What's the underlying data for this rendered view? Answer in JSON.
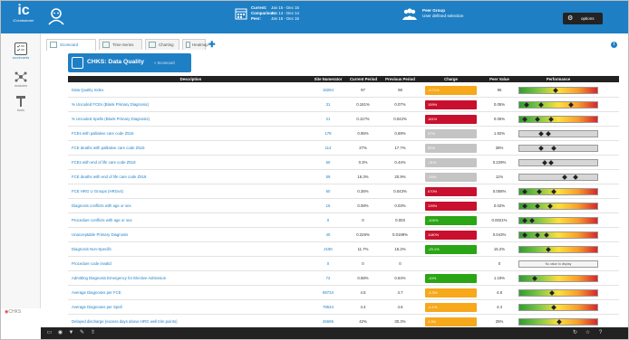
{
  "app": {
    "logo_text": "ic",
    "logo_sub": "iComissioner"
  },
  "header": {
    "current_label": "Current:",
    "current_value": "Jan 15 - Dec 15",
    "comparison_label": "Comparison:",
    "comparison_value": "Jan 14 - Dec 14",
    "peer_label": "Peer:",
    "peer_value": "Jan 15 - Dec 15",
    "peer_group_title": "Peer Group",
    "peer_group_value": "User defined selection",
    "options_label": "options"
  },
  "sidebar": {
    "items": [
      {
        "label": "scorecards",
        "icon": "checklist-icon"
      },
      {
        "label": "modules",
        "icon": "modules-icon"
      },
      {
        "label": "tools",
        "icon": "tools-icon"
      }
    ],
    "brand": "CHKS"
  },
  "tabs": [
    {
      "label": "Scorecard"
    },
    {
      "label": "Time-Series"
    },
    {
      "label": "Charting"
    },
    {
      "label": "Heatmap"
    }
  ],
  "scorecard": {
    "title": "CHKS: Data Quality",
    "crumb": "» Scorecard"
  },
  "table": {
    "headers": {
      "description": "Description",
      "numerator": "Site Numerator",
      "current": "Current Period",
      "previous": "Previous Period",
      "change": "Charge",
      "peer": "Peer Value",
      "performance": "Performance"
    },
    "rows": [
      {
        "desc": "Data Quality Index",
        "num": "18284",
        "cur": "97",
        "prev": "98",
        "chg": "-0.71%",
        "chg_color": "orange",
        "peer": "96",
        "perf": "grad",
        "note": ""
      },
      {
        "desc": "% Uncoded FCEs (Blank Primary Diagnosis)",
        "num": "31",
        "cur": "0.181%",
        "prev": "0.07%",
        "chg": "159%",
        "chg_color": "red",
        "peer": "0.05%",
        "perf": "grad",
        "note": ""
      },
      {
        "desc": "% Uncoded Spells (Blank Primary Diagnosis)",
        "num": "21",
        "cur": "0.117%",
        "prev": "0.042%",
        "chg": "181%",
        "chg_color": "red",
        "peer": "0.06%",
        "perf": "grad",
        "note": ""
      },
      {
        "desc": "FCEs with palliative care code Z515",
        "num": "178",
        "cur": "0.95%",
        "prev": "0.69%",
        "chg": "37%",
        "chg_color": "grey",
        "peer": "1.92%",
        "perf": "grey",
        "note": ""
      },
      {
        "desc": "FCE deaths with palliative care code Z515",
        "num": "114",
        "cur": "27%",
        "prev": "17.7%",
        "chg": "52%",
        "chg_color": "grey",
        "peer": "38%",
        "perf": "grey",
        "note": ""
      },
      {
        "desc": "FCEs with end of life care code Z518",
        "num": "60",
        "cur": "0.3%",
        "prev": "0.44%",
        "chg": "-31%",
        "chg_color": "grey",
        "peer": "0.229%",
        "perf": "grey",
        "note": ""
      },
      {
        "desc": "FCE deaths with end of life care code Z518",
        "num": "59",
        "cur": "16.3%",
        "prev": "20.9%",
        "chg": "-29%",
        "chg_color": "grey",
        "peer": "11%",
        "perf": "grey",
        "note": ""
      },
      {
        "desc": "FCE HRG U Groups (HRGv4)",
        "num": "60",
        "cur": "0.35%",
        "prev": "0.043%",
        "chg": "670%",
        "chg_color": "red",
        "peer": "0.058%",
        "perf": "grad",
        "note": ""
      },
      {
        "desc": "Diagnosis conflicts with age or sex",
        "num": "15",
        "cur": "0.08%",
        "prev": "0.03%",
        "chg": "139%",
        "chg_color": "red",
        "peer": "0.02%",
        "perf": "grad",
        "note": ""
      },
      {
        "desc": "Procedure conflicts with age or sex",
        "num": "0",
        "cur": "0",
        "prev": "0.003",
        "chg": "-100%",
        "chg_color": "green",
        "peer": "0.0021%",
        "perf": "grad",
        "note": ""
      },
      {
        "desc": "Unacceptable Primary Diagnosis",
        "num": "40",
        "cur": "0.226%",
        "prev": "0.0199%",
        "chg": "1180%",
        "chg_color": "red",
        "peer": "0.043%",
        "perf": "grad",
        "note": ""
      },
      {
        "desc": "Diagnosis Non-Specific",
        "num": "2190",
        "cur": "11.7%",
        "prev": "15.2%",
        "chg": "-23.1%",
        "chg_color": "green",
        "peer": "15.2%",
        "perf": "grad",
        "note": ""
      },
      {
        "desc": "Procedure code invalid",
        "num": "0",
        "cur": "0",
        "prev": "0",
        "chg": "",
        "chg_color": "none",
        "peer": "0",
        "perf": "note",
        "note": "No value to display"
      },
      {
        "desc": "Admitting Diagnosis Emergency for Elective Admission",
        "num": "72",
        "cur": "0.58%",
        "prev": "0.64%",
        "chg": "-10%",
        "chg_color": "green",
        "peer": "1.19%",
        "perf": "grad",
        "note": ""
      },
      {
        "desc": "Average Diagnoses per FCE",
        "num": "89734",
        "cur": "4.5",
        "prev": "4.7",
        "chg": "-4.3%",
        "chg_color": "orange",
        "peer": "4.8",
        "perf": "grad",
        "note": ""
      },
      {
        "desc": "Average Diagnoses per Spell",
        "num": "78534",
        "cur": "4.4",
        "prev": "4.6",
        "chg": "-4.1%",
        "chg_color": "orange",
        "peer": "4.4",
        "perf": "grad",
        "note": ""
      },
      {
        "desc": "Delayed discharge (excess days above HRG well trim points)",
        "num": "26695",
        "cur": "42%",
        "prev": "30.3%",
        "chg": "4.3%",
        "chg_color": "orange",
        "peer": "25%",
        "perf": "grad",
        "note": ""
      }
    ]
  },
  "colors": {
    "brand_blue": "#1f7fc4",
    "header_dark": "#222222",
    "red": "#c8102e",
    "orange": "#f7a81b",
    "green": "#2aa515",
    "grey": "#c4c4c4"
  }
}
